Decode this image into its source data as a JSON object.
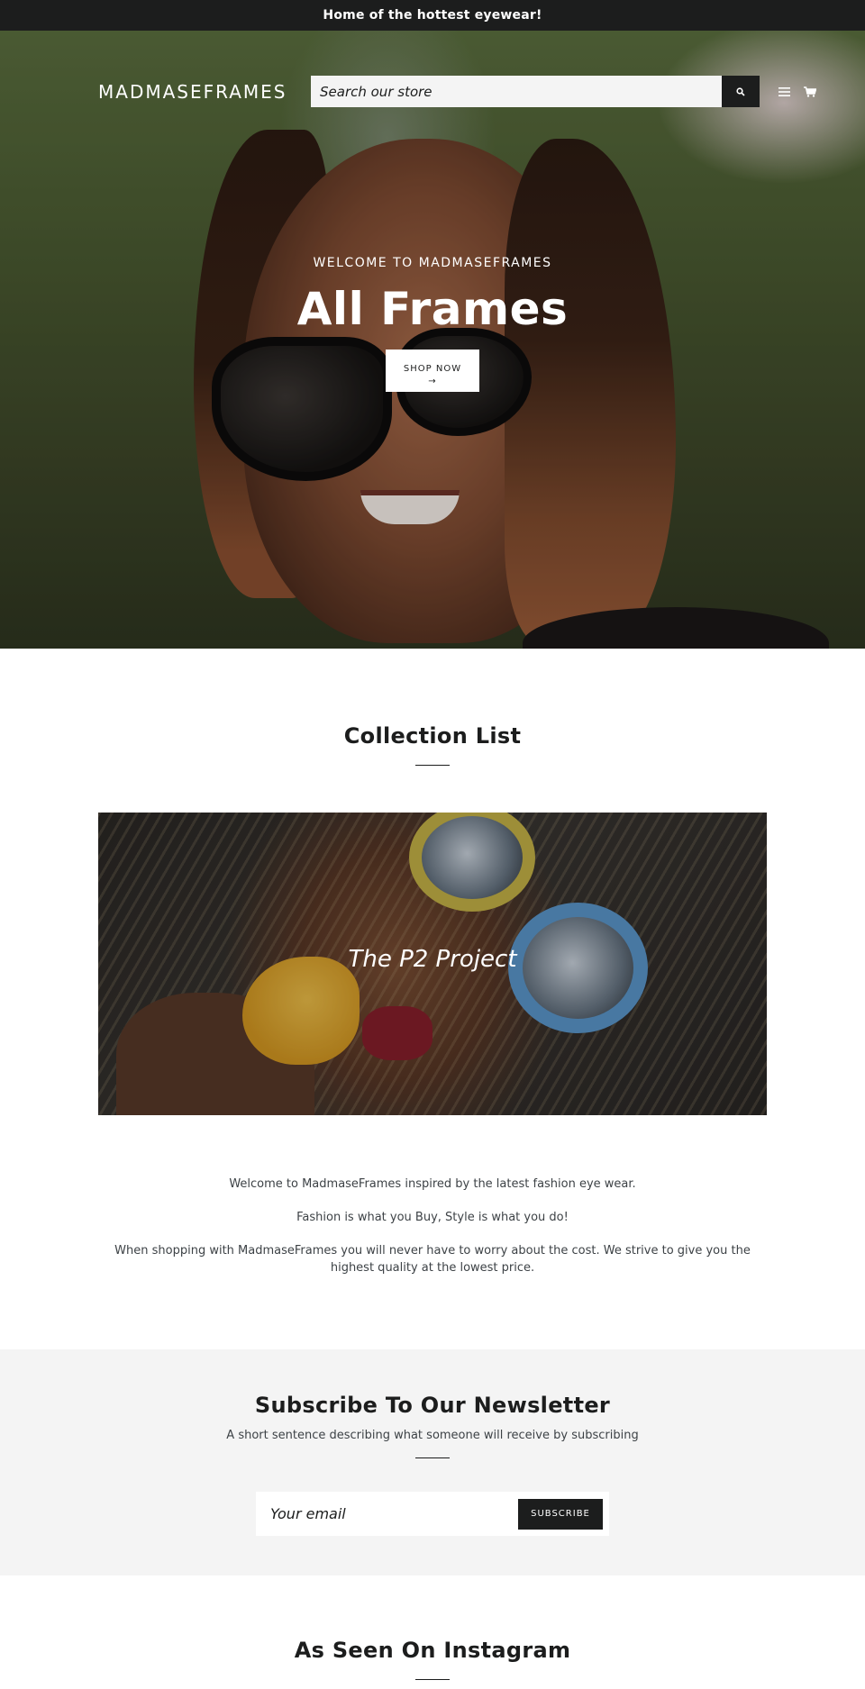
{
  "announcement": {
    "text": "Home of the hottest eyewear!"
  },
  "header": {
    "logo": "MADMASEFRAMES",
    "search_placeholder": "Search our store",
    "search_icon": "search-icon",
    "menu_icon": "hamburger-menu-icon",
    "cart_icon": "cart-icon"
  },
  "hero": {
    "kicker": "WELCOME TO MADMASEFRAMES",
    "title": "All Frames",
    "button_label": "SHOP NOW",
    "button_arrow": "→",
    "slides_total": 3,
    "slide_active_index": 0
  },
  "collection": {
    "heading": "Collection List",
    "items": [
      {
        "label": "The P2 Project"
      }
    ]
  },
  "intro": {
    "paragraphs": [
      "Welcome to MadmaseFrames inspired by the latest fashion eye wear.",
      "Fashion is what you Buy, Style is what you do!",
      "When shopping with MadmaseFrames you will never have to worry about the cost. We strive to give you the highest quality at the lowest price."
    ]
  },
  "newsletter": {
    "heading": "Subscribe To Our Newsletter",
    "subtext": "A short sentence describing what someone will receive by subscribing",
    "email_placeholder": "Your email",
    "button_label": "SUBSCRIBE"
  },
  "instagram": {
    "heading": "As Seen On Instagram"
  },
  "colors": {
    "dark": "#1c1d1d",
    "light_bg": "#f4f4f4",
    "white": "#ffffff",
    "body_text": "#3d4246"
  }
}
